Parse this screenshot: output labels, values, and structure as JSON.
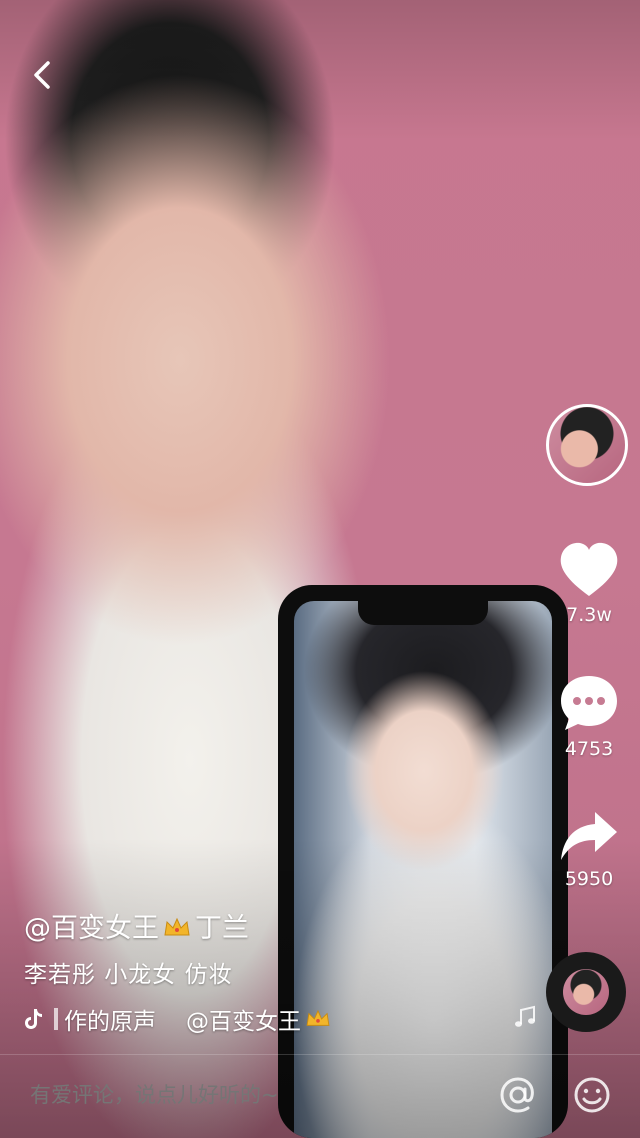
{
  "author": {
    "username_prefix": "@百变女王",
    "username_suffix": "丁兰"
  },
  "caption": "李若彤 小龙女 仿妆",
  "music": {
    "label_partial": "作的原声",
    "credit_prefix": "@百变女王"
  },
  "stats": {
    "likes": "7.3w",
    "comments": "4753",
    "shares": "5950"
  },
  "comment_box": {
    "placeholder": "有爱评论，说点儿好听的~"
  },
  "icons": {
    "back": "chevron-left-icon",
    "like": "heart-icon",
    "comment": "speech-bubble-icon",
    "share": "share-arrow-icon",
    "music": "music-note-icon",
    "tiktok": "tiktok-logo-icon",
    "crown": "crown-emoji-icon",
    "mention": "at-sign-icon",
    "emoji": "smiley-icon"
  },
  "colors": {
    "background": "#c67b92",
    "text": "#ffffff",
    "crown": "#f2b52a"
  }
}
